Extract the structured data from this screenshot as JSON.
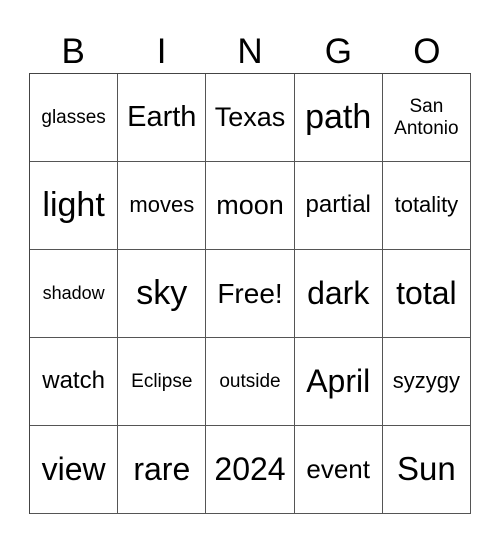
{
  "header": [
    "B",
    "I",
    "N",
    "G",
    "O"
  ],
  "cells": [
    {
      "text": "glasses",
      "size": 19
    },
    {
      "text": "Earth",
      "size": 29
    },
    {
      "text": "Texas",
      "size": 27
    },
    {
      "text": "path",
      "size": 34
    },
    {
      "text": "San\nAntonio",
      "size": 19
    },
    {
      "text": "light",
      "size": 34
    },
    {
      "text": "moves",
      "size": 22
    },
    {
      "text": "moon",
      "size": 27
    },
    {
      "text": "partial",
      "size": 24
    },
    {
      "text": "totality",
      "size": 22
    },
    {
      "text": "shadow",
      "size": 18
    },
    {
      "text": "sky",
      "size": 34
    },
    {
      "text": "Free!",
      "size": 28
    },
    {
      "text": "dark",
      "size": 32
    },
    {
      "text": "total",
      "size": 32
    },
    {
      "text": "watch",
      "size": 24
    },
    {
      "text": "Eclipse",
      "size": 19
    },
    {
      "text": "outside",
      "size": 19
    },
    {
      "text": "April",
      "size": 32
    },
    {
      "text": "syzygy",
      "size": 22
    },
    {
      "text": "view",
      "size": 32
    },
    {
      "text": "rare",
      "size": 32
    },
    {
      "text": "2024",
      "size": 32
    },
    {
      "text": "event",
      "size": 26
    },
    {
      "text": "Sun",
      "size": 33
    }
  ]
}
